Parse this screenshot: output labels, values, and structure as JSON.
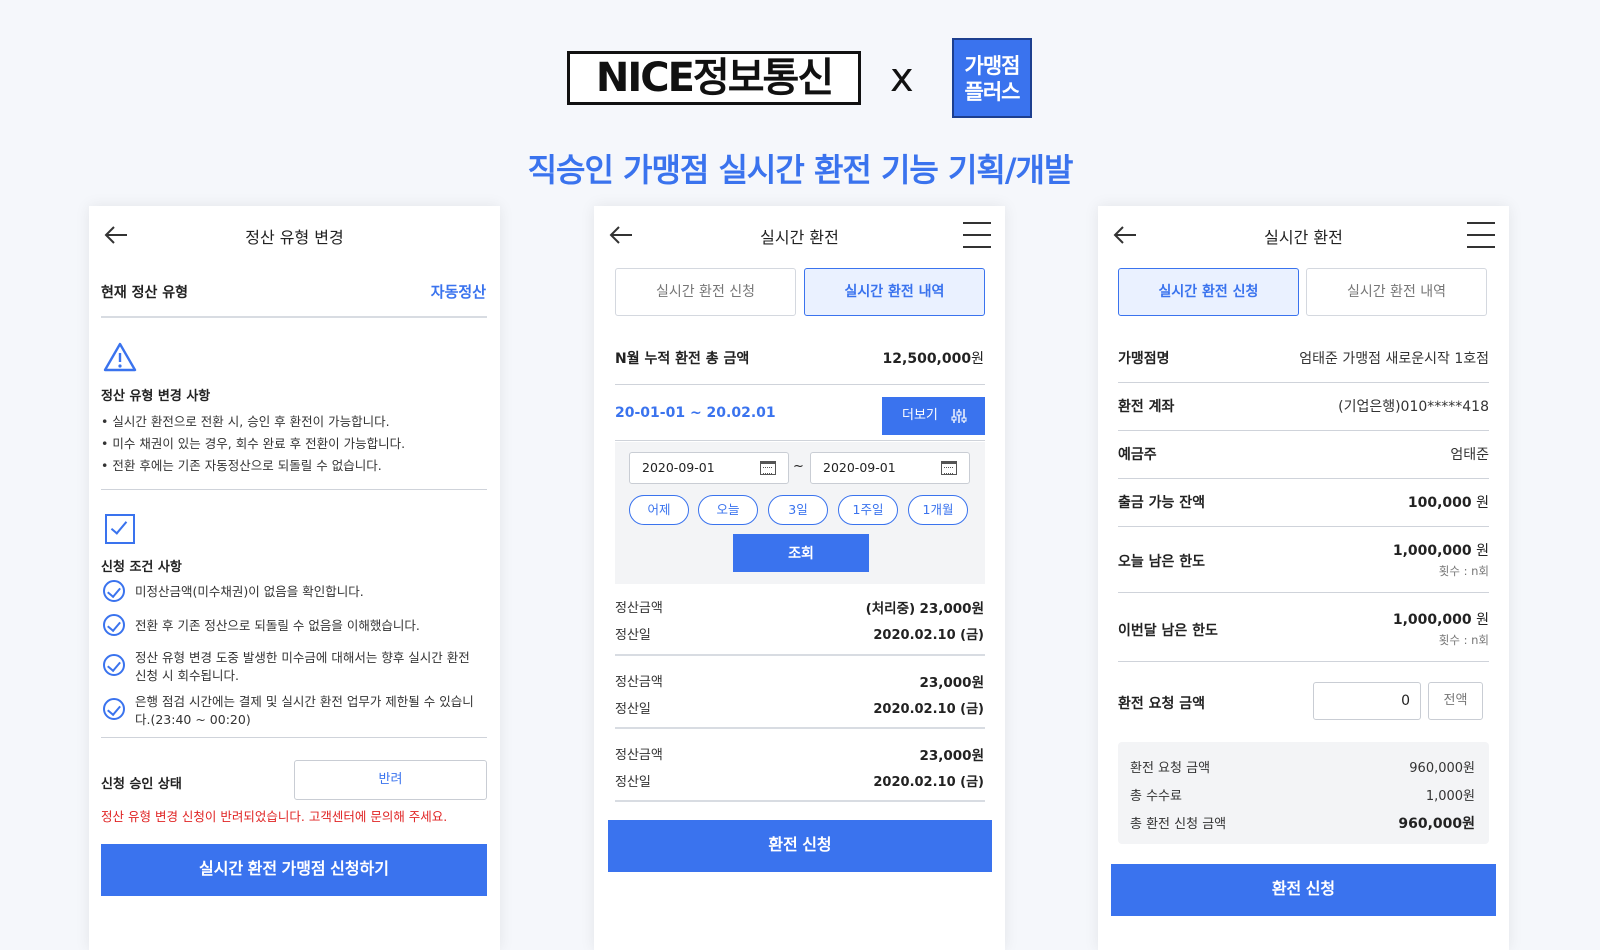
{
  "header": {
    "logo_nice": "NICE정보통신",
    "logo_x": "x",
    "logo_gm_line1": "가맹점",
    "logo_gm_line2": "플러스",
    "title": "직승인 가맹점 실시간 환전 기능 기획/개발"
  },
  "screen1": {
    "title": "정산 유형 변경",
    "current_type_label": "현재 정산 유형",
    "current_type_value": "자동정산",
    "notice_title": "정산 유형 변경 사항",
    "notices": [
      "• 실시간 환전으로 전환 시, 승인 후 환전이 가능합니다.",
      "• 미수 채권이 있는 경우, 회수 완료 후 전환이 가능합니다.",
      "• 전환 후에는 기존 자동정산으로 되돌릴 수 없습니다."
    ],
    "conditions_title": "신청 조건 사항",
    "conditions": [
      "미정산금액(미수채권)이 없음을 확인합니다.",
      "전환 후 기존 정산으로 되돌릴 수 없음을 이해했습니다.",
      "정산 유형 변경 도중 발생한 미수금에 대해서는 향후 실시간 환전 신청 시 회수됩니다.",
      "은행 점검 시간에는 결제 및 실시간 환전 업무가 제한될 수 있습니다.(23:40 ~ 00:20)"
    ],
    "status_label": "신청 승인 상태",
    "status_value": "반려",
    "reject_message": "정산 유형 변경 신청이 반려되었습니다. 고객센터에 문의해 주세요.",
    "apply_button": "실시간 환전 가맹점 신청하기"
  },
  "screen2": {
    "title": "실시간 환전",
    "tab_apply": "실시간 환전 신청",
    "tab_history": "실시간 환전 내역",
    "total_label": "N월 누적 환전 총 금액",
    "total_value": "12,500,000",
    "won": "원",
    "period": "20-01-01 ~ 20.02.01",
    "more_button": "더보기",
    "date_from": "2020-09-01",
    "date_tilde": "~",
    "date_to": "2020-09-01",
    "chips": [
      "어제",
      "오늘",
      "3일",
      "1주일",
      "1개월"
    ],
    "search_button": "조회",
    "records": [
      {
        "amount_label": "정산금액",
        "status": "(처리중)",
        "amount": "23,000원",
        "date_label": "정산일",
        "date": "2020.02.10 (금)"
      },
      {
        "amount_label": "정산금액",
        "status": "",
        "amount": "23,000원",
        "date_label": "정산일",
        "date": "2020.02.10 (금)"
      },
      {
        "amount_label": "정산금액",
        "status": "",
        "amount": "23,000원",
        "date_label": "정산일",
        "date": "2020.02.10 (금)"
      }
    ],
    "apply_button": "환전 신청"
  },
  "screen3": {
    "title": "실시간 환전",
    "tab_apply": "실시간 환전 신청",
    "tab_history": "실시간 환전 내역",
    "store_label": "가맹점명",
    "store_value": "엄태준 가맹점 새로운시작 1호점",
    "account_label": "환전 계좌",
    "account_value": "(기업은행)010*****418",
    "holder_label": "예금주",
    "holder_value": "엄태준",
    "balance_label": "출금 가능 잔액",
    "balance_value": "100,000",
    "won": "원",
    "today_limit_label": "오늘 남은 한도",
    "today_limit_value": "1,000,000",
    "today_count": "횟수 : n회",
    "month_limit_label": "이번달 남은 한도",
    "month_limit_value": "1,000,000",
    "month_count": "횟수 : n회",
    "request_label": "환전 요청 금액",
    "request_input": "0",
    "all_button": "전액",
    "summary": [
      {
        "label": "환전 요청 금액",
        "value": "960,000원"
      },
      {
        "label": "총 수수료",
        "value": "1,000원"
      },
      {
        "label": "총 환전 신청 금액",
        "value": "960,000원"
      }
    ],
    "apply_button": "환전 신청"
  },
  "colors": {
    "accent": "#3a73ee",
    "error": "#e02424"
  }
}
